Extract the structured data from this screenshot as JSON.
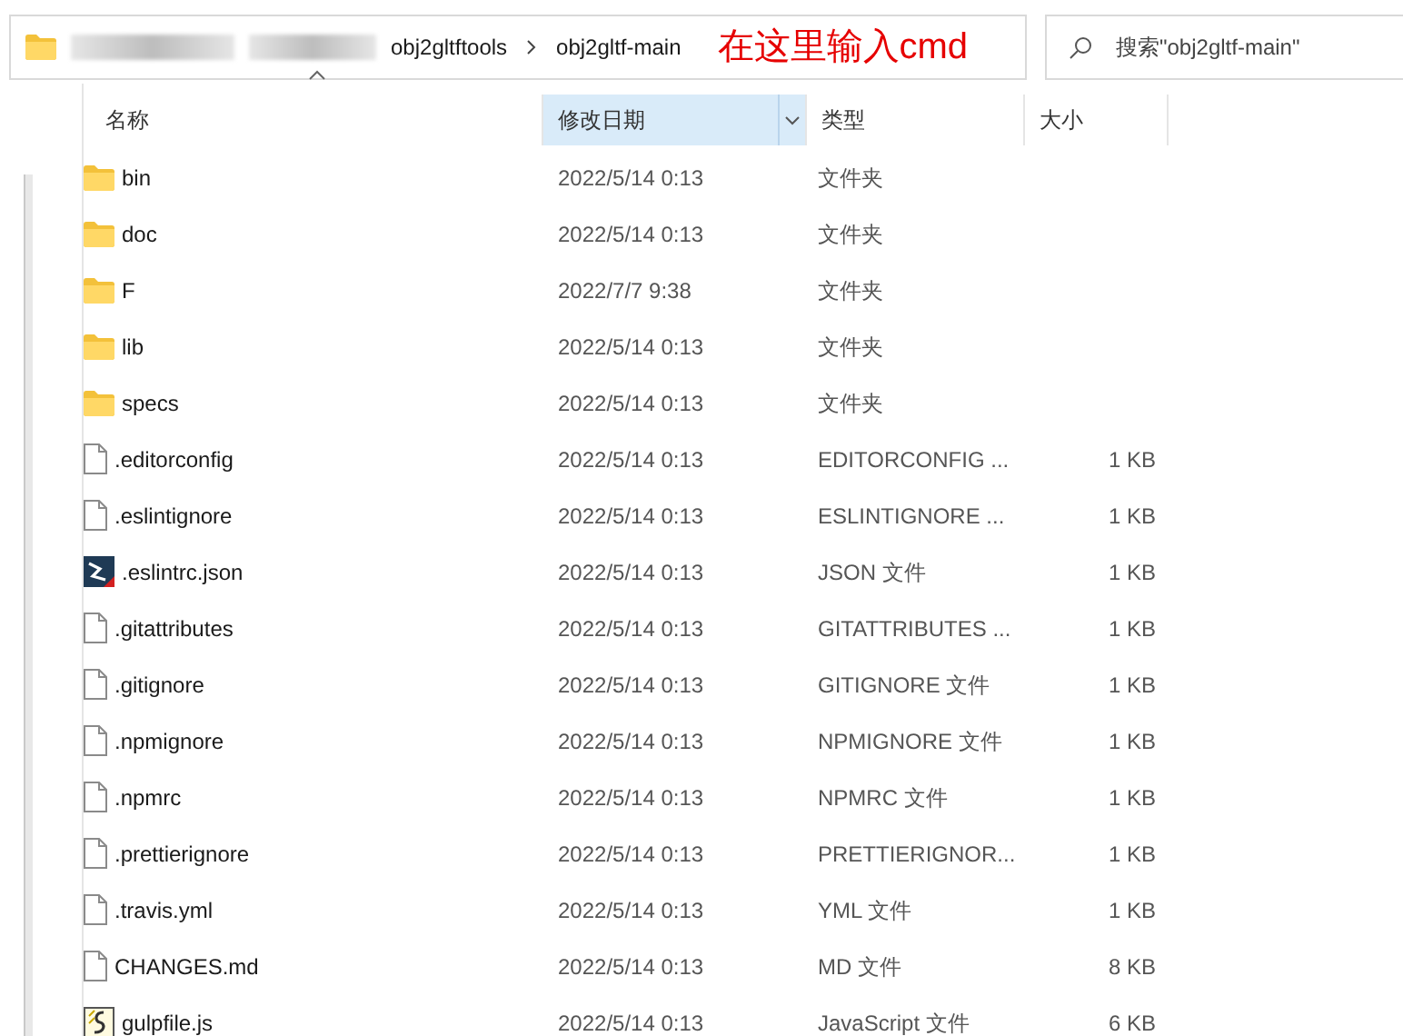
{
  "address_bar": {
    "crumbs": [
      "obj2gltftools",
      "obj2gltf-main"
    ],
    "annotation": "在这里输入cmd"
  },
  "search": {
    "placeholder": "搜索\"obj2gltf-main\""
  },
  "columns": [
    {
      "label": "名称",
      "selected": false,
      "sorted": true
    },
    {
      "label": "修改日期",
      "selected": true,
      "sorted": false
    },
    {
      "label": "类型",
      "selected": false,
      "sorted": false
    },
    {
      "label": "大小",
      "selected": false,
      "sorted": false
    }
  ],
  "files": [
    {
      "kind": "folder",
      "name": "bin",
      "date": "2022/5/14 0:13",
      "type": "文件夹"
    },
    {
      "kind": "folder",
      "name": "doc",
      "date": "2022/5/14 0:13",
      "type": "文件夹"
    },
    {
      "kind": "folder",
      "name": "F",
      "date": "2022/7/7 9:38",
      "type": "文件夹"
    },
    {
      "kind": "folder",
      "name": "lib",
      "date": "2022/5/14 0:13",
      "type": "文件夹"
    },
    {
      "kind": "folder",
      "name": "specs",
      "date": "2022/5/14 0:13",
      "type": "文件夹"
    },
    {
      "kind": "file",
      "name": ".editorconfig",
      "date": "2022/5/14 0:13",
      "type": "EDITORCONFIG ...",
      "size": "1 KB"
    },
    {
      "kind": "file",
      "name": ".eslintignore",
      "date": "2022/5/14 0:13",
      "type": "ESLINTIGNORE ...",
      "size": "1 KB"
    },
    {
      "kind": "app",
      "name": ".eslintrc.json",
      "date": "2022/5/14 0:13",
      "type": "JSON 文件",
      "size": "1 KB"
    },
    {
      "kind": "file",
      "name": ".gitattributes",
      "date": "2022/5/14 0:13",
      "type": "GITATTRIBUTES ...",
      "size": "1 KB"
    },
    {
      "kind": "file",
      "name": ".gitignore",
      "date": "2022/5/14 0:13",
      "type": "GITIGNORE 文件",
      "size": "1 KB"
    },
    {
      "kind": "file",
      "name": ".npmignore",
      "date": "2022/5/14 0:13",
      "type": "NPMIGNORE 文件",
      "size": "1 KB"
    },
    {
      "kind": "file",
      "name": ".npmrc",
      "date": "2022/5/14 0:13",
      "type": "NPMRC 文件",
      "size": "1 KB"
    },
    {
      "kind": "file",
      "name": ".prettierignore",
      "date": "2022/5/14 0:13",
      "type": "PRETTIERIGNOR...",
      "size": "1 KB"
    },
    {
      "kind": "file",
      "name": ".travis.yml",
      "date": "2022/5/14 0:13",
      "type": "YML 文件",
      "size": "1 KB"
    },
    {
      "kind": "file",
      "name": "CHANGES.md",
      "date": "2022/5/14 0:13",
      "type": "MD 文件",
      "size": "8 KB"
    },
    {
      "kind": "script",
      "name": "gulpfile.js",
      "date": "2022/5/14 0:13",
      "type": "JavaScript 文件",
      "size": "6 KB"
    }
  ]
}
